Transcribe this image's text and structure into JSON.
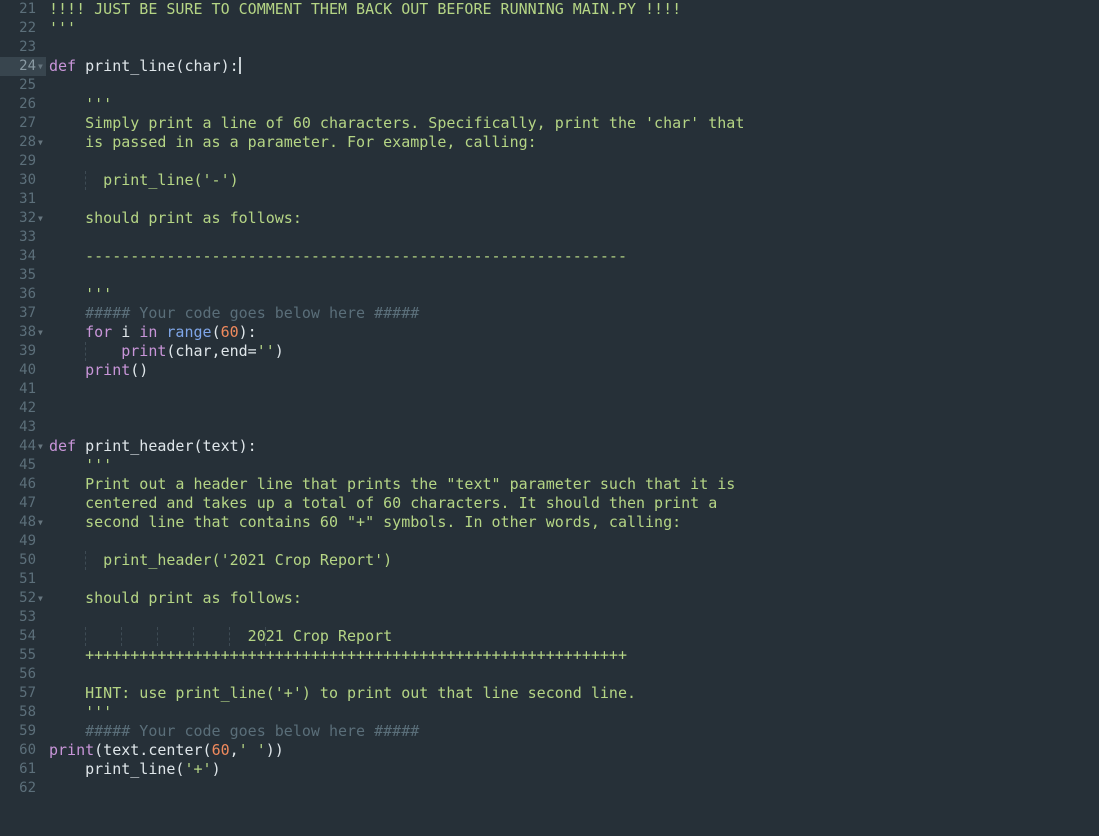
{
  "editor": {
    "active_line": 24,
    "colors": {
      "background": "#263038",
      "docstring": "#b5d585",
      "keyword": "#c895d8",
      "number": "#f08a5d",
      "comment": "#5a6e79",
      "builtin_range": "#7fa6e8"
    },
    "lines": [
      {
        "n": "21",
        "text": "!!!! JUST BE SURE TO COMMENT THEM BACK OUT BEFORE RUNNING MAIN.PY !!!!"
      },
      {
        "n": "22",
        "text": "'''"
      },
      {
        "n": "23",
        "text": ""
      },
      {
        "n": "24",
        "kw": "def",
        "rest": " print_line(char):"
      },
      {
        "n": "25",
        "text": ""
      },
      {
        "n": "26",
        "text": "    '''"
      },
      {
        "n": "27",
        "text": "    Simply print a line of 60 characters. Specifically, print the 'char' that"
      },
      {
        "n": "28",
        "text": "    is passed in as a parameter. For example, calling:"
      },
      {
        "n": "29",
        "text": ""
      },
      {
        "n": "30",
        "text": "      print_line('-')"
      },
      {
        "n": "31",
        "text": ""
      },
      {
        "n": "32",
        "text": "    should print as follows:"
      },
      {
        "n": "33",
        "text": ""
      },
      {
        "n": "34",
        "text": "    ------------------------------------------------------------"
      },
      {
        "n": "35",
        "text": ""
      },
      {
        "n": "36",
        "text": "    '''"
      },
      {
        "n": "37",
        "text": "    ##### Your code goes below here #####"
      },
      {
        "n": "38",
        "for": "for",
        "i": " i ",
        "in": "in",
        "range": "range",
        "open": "(",
        "num": "60",
        "close": "):"
      },
      {
        "n": "39",
        "print": "print",
        "args": "(char,end=",
        "str": "''",
        "end": ")"
      },
      {
        "n": "40",
        "print": "print",
        "args": "()"
      },
      {
        "n": "41",
        "text": ""
      },
      {
        "n": "42",
        "text": ""
      },
      {
        "n": "43",
        "text": ""
      },
      {
        "n": "44",
        "kw": "def",
        "rest": " print_header(text):"
      },
      {
        "n": "45",
        "text": "    '''"
      },
      {
        "n": "46",
        "text": "    Print out a header line that prints the \"text\" parameter such that it is"
      },
      {
        "n": "47",
        "text": "    centered and takes up a total of 60 characters. It should then print a"
      },
      {
        "n": "48",
        "text": "    second line that contains 60 \"+\" symbols. In other words, calling:"
      },
      {
        "n": "49",
        "text": ""
      },
      {
        "n": "50",
        "text": "      print_header('2021 Crop Report')"
      },
      {
        "n": "51",
        "text": ""
      },
      {
        "n": "52",
        "text": "    should print as follows:"
      },
      {
        "n": "53",
        "text": ""
      },
      {
        "n": "54",
        "text": "                      2021 Crop Report"
      },
      {
        "n": "55",
        "text": "    ++++++++++++++++++++++++++++++++++++++++++++++++++++++++++++"
      },
      {
        "n": "56",
        "text": ""
      },
      {
        "n": "57",
        "text": "    HINT: use print_line('+') to print out that line second line."
      },
      {
        "n": "58",
        "text": "    '''"
      },
      {
        "n": "59",
        "text": "    ##### Your code goes below here #####"
      },
      {
        "n": "60",
        "print": "print",
        "args": "(text.center(",
        "num": "60",
        "comma": ",",
        "str": "' '",
        "end": "))"
      },
      {
        "n": "61",
        "text": "    print_line('+')"
      },
      {
        "n": "62",
        "text": ""
      }
    ]
  }
}
